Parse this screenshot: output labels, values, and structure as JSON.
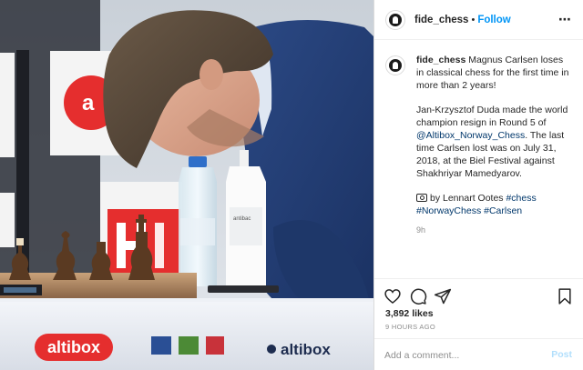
{
  "post": {
    "username": "fide_chess",
    "separator": "•",
    "follow_label": "Follow",
    "more_icon": "⋯",
    "caption": {
      "username": "fide_chess",
      "line1": "Magnus Carlsen loses in classical chess for the first time in more than 2 years!",
      "line2_pre": "Jan-Krzysztof Duda made the world champion resign in Round 5 of ",
      "line2_link": "@Altibox_Norway_Chess",
      "line2_post": ". The last time Carlsen lost was on July 31, 2018, at the Biel Festival against Shakhriyar Mamedyarov.",
      "credit_pre": "by Lennart Ootes ",
      "tag_chess": "#chess",
      "tag_norway": "#NorwayChess",
      "tag_carlsen": "#Carlsen",
      "age_short": "9h"
    },
    "likes": "3,892 likes",
    "age_long": "9 HOURS AGO",
    "comment_placeholder": "Add a comment...",
    "post_label": "Post"
  },
  "photo": {
    "banner_brand": "altibox",
    "sponsor_text": "altibox"
  },
  "colors": {
    "follow": "#0095f6",
    "link": "#00376b",
    "muted": "#8e8e8e",
    "post_disabled": "#b2dffc",
    "brand_red": "#e52e2e"
  },
  "icons": [
    "avatar-logo-icon",
    "more-options-icon",
    "heart-icon",
    "comment-icon",
    "share-icon",
    "bookmark-icon",
    "camera-icon"
  ]
}
